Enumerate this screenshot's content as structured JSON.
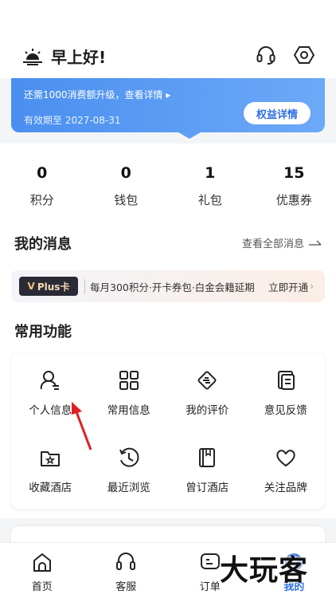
{
  "header": {
    "greeting": "早上好!",
    "icons": [
      "sun-icon",
      "customer-service-icon",
      "settings-icon"
    ]
  },
  "banner": {
    "upgrade_tip": "还需1000消费额升级，查看详情 ▸",
    "expiry": "有效期至 2027-08-31",
    "rights_button": "权益详情"
  },
  "stats": [
    {
      "value": "0",
      "label": "积分"
    },
    {
      "value": "0",
      "label": "钱包"
    },
    {
      "value": "1",
      "label": "礼包"
    },
    {
      "value": "15",
      "label": "优惠券"
    }
  ],
  "messages": {
    "title": "我的消息",
    "view_all": "查看全部消息",
    "plus_badge": "Plus卡",
    "plus_badge_mark": "V",
    "plus_desc": "每月300积分·开卡券包·白金会籍延期",
    "plus_action": "立即开通"
  },
  "functions": {
    "title": "常用功能",
    "items": [
      {
        "label": "个人信息",
        "icon": "user-icon"
      },
      {
        "label": "常用信息",
        "icon": "grid-icon"
      },
      {
        "label": "我的评价",
        "icon": "handshake-icon"
      },
      {
        "label": "意见反馈",
        "icon": "feedback-icon"
      },
      {
        "label": "收藏酒店",
        "icon": "favorite-folder-icon"
      },
      {
        "label": "最近浏览",
        "icon": "history-icon"
      },
      {
        "label": "曾订酒店",
        "icon": "booked-book-icon"
      },
      {
        "label": "关注品牌",
        "icon": "heart-icon"
      }
    ]
  },
  "tabbar": {
    "items": [
      {
        "label": "首页",
        "icon": "home-icon",
        "active": false
      },
      {
        "label": "客服",
        "icon": "headset-icon",
        "active": false
      },
      {
        "label": "订单",
        "icon": "order-icon",
        "active": false
      },
      {
        "label": "我的",
        "icon": "profile-icon",
        "active": true
      }
    ]
  },
  "watermark": "大玩客",
  "colors": {
    "accent": "#2f6fe0",
    "banner": "#4a8ff0",
    "arrow": "#e02020"
  }
}
